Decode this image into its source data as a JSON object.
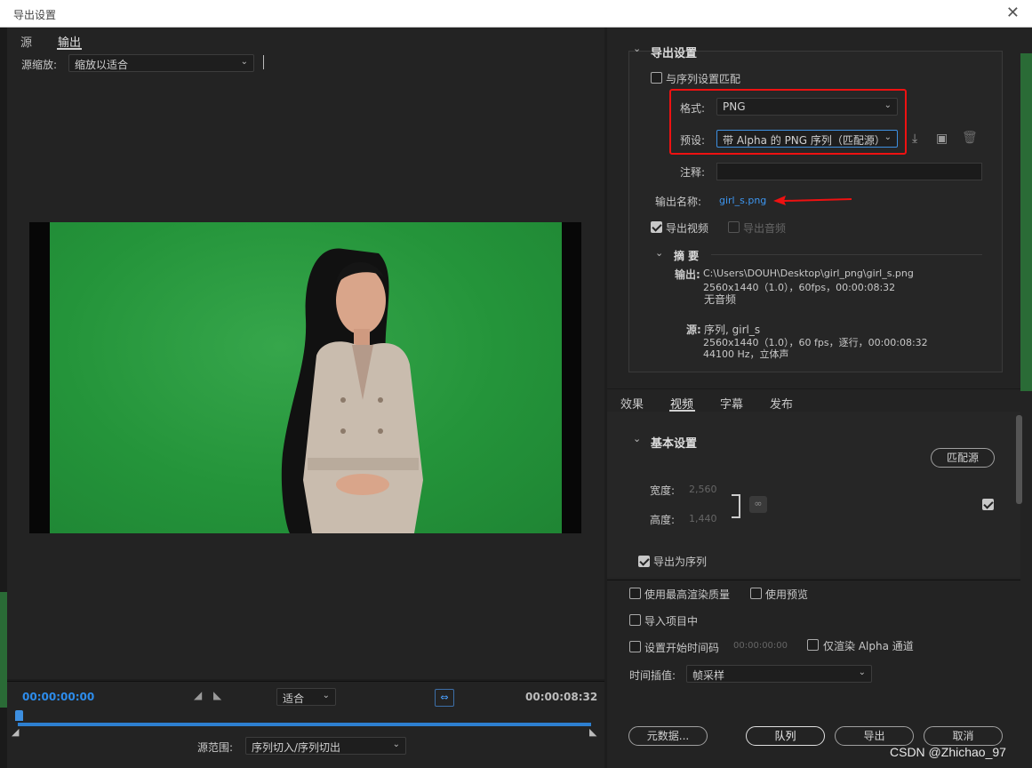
{
  "window": {
    "title": "导出设置",
    "close_icon": "close-icon"
  },
  "source_panel": {
    "tabs": [
      "源",
      "输出"
    ],
    "active_tab": "输出",
    "scale_label": "源缩放:",
    "scale_value": "缩放以适合"
  },
  "timeline": {
    "timecode_start": "00:00:00:00",
    "fit_value": "适合",
    "timecode_end": "00:00:08:32",
    "range_label": "源范围:",
    "range_value": "序列切入/序列切出"
  },
  "export_settings": {
    "header": "导出设置",
    "match_sequence": "与序列设置匹配",
    "format_label": "格式:",
    "format_value": "PNG",
    "preset_label": "预设:",
    "preset_value": "带 Alpha 的 PNG 序列（匹配源）",
    "comment_label": "注释:",
    "comment_value": "",
    "output_name_label": "输出名称:",
    "output_name_value": "girl_s.png",
    "export_video": "导出视频",
    "export_audio": "导出音频",
    "summary_header": "摘 要",
    "output_label": "输出:",
    "output_line1": "C:\\Users\\DOUH\\Desktop\\girl_png\\girl_s.png",
    "output_line2": "2560x1440（1.0），60fps，00:00:08:32",
    "output_line3": "无音频",
    "source_label": "源:",
    "source_line1": "序列, girl_s",
    "source_line2": "2560x1440（1.0），60 fps，逐行，00:00:08:32",
    "source_line3": "44100 Hz，立体声"
  },
  "settings_tabs": {
    "items": [
      "效果",
      "视频",
      "字幕",
      "发布"
    ],
    "active": "视频"
  },
  "basic": {
    "header": "基本设置",
    "match_source": "匹配源",
    "width_label": "宽度:",
    "width_value": "2,560",
    "height_label": "高度:",
    "height_value": "1,440",
    "export_as_sequence": "导出为序列"
  },
  "options": {
    "max_quality": "使用最高渲染质量",
    "use_preview": "使用预览",
    "import_project": "导入项目中",
    "set_start_tc": "设置开始时间码",
    "start_tc_value": "00:00:00:00",
    "alpha_only": "仅渲染 Alpha 通道",
    "interp_label": "时间插值:",
    "interp_value": "帧采样"
  },
  "buttons": {
    "metadata": "元数据...",
    "queue": "队列",
    "export": "导出",
    "cancel": "取消"
  },
  "watermark": "CSDN @Zhichao_97",
  "colors": {
    "accent_blue": "#2d8ceb",
    "red_annotation": "#e11111",
    "green_screen": "#24943a"
  }
}
